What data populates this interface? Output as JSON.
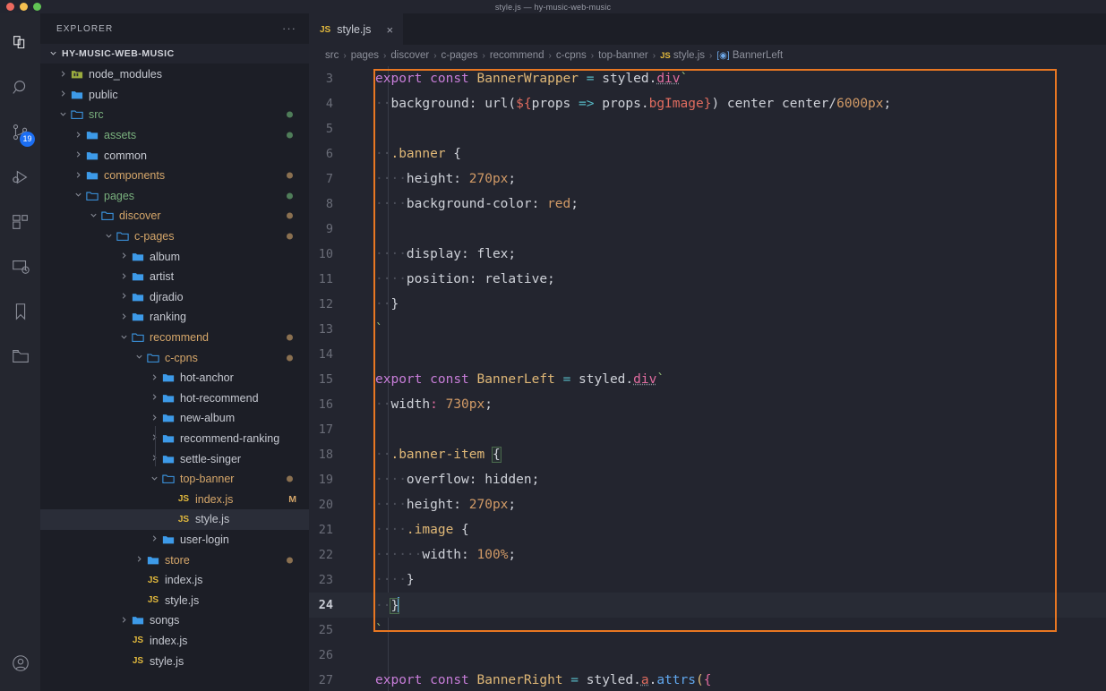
{
  "window": {
    "title": "style.js — hy-music-web-music",
    "traffic_lights": [
      "close",
      "minimize",
      "zoom"
    ]
  },
  "activity_bar": {
    "items": [
      {
        "name": "explorer-icon",
        "label": "Explorer",
        "active": true,
        "badge": null
      },
      {
        "name": "search-icon",
        "label": "Search",
        "active": false,
        "badge": null
      },
      {
        "name": "source-control-icon",
        "label": "Source Control",
        "active": false,
        "badge": "19"
      },
      {
        "name": "run-and-debug-icon",
        "label": "Run and Debug",
        "active": false,
        "badge": null
      },
      {
        "name": "extensions-icon",
        "label": "Extensions",
        "active": false,
        "badge": null
      },
      {
        "name": "remote-explorer-icon",
        "label": "Remote Explorer",
        "active": false,
        "badge": null
      },
      {
        "name": "bookmarks-icon",
        "label": "Bookmarks",
        "active": false,
        "badge": null
      },
      {
        "name": "project-manager-icon",
        "label": "Project Manager",
        "active": false,
        "badge": null
      }
    ],
    "bottom": [
      {
        "name": "accounts-icon",
        "label": "Accounts"
      }
    ]
  },
  "sidebar": {
    "header_title": "EXPLORER",
    "more_actions": "···",
    "root_label": "HY-MUSIC-WEB-MUSIC",
    "root_chevron": "⌄",
    "tree": [
      {
        "label": "node_modules",
        "depth": 1,
        "type": "folder-special",
        "state": "collapsed",
        "status": null,
        "badge": null,
        "selected": false
      },
      {
        "label": "public",
        "depth": 1,
        "type": "folder",
        "state": "collapsed",
        "status": null,
        "badge": null,
        "selected": false
      },
      {
        "label": "src",
        "depth": 1,
        "type": "folder",
        "state": "expanded",
        "status": "new",
        "badge": null,
        "selected": false
      },
      {
        "label": "assets",
        "depth": 2,
        "type": "folder",
        "state": "collapsed",
        "status": "new",
        "badge": null,
        "selected": false
      },
      {
        "label": "common",
        "depth": 2,
        "type": "folder",
        "state": "collapsed",
        "status": null,
        "badge": null,
        "selected": false
      },
      {
        "label": "components",
        "depth": 2,
        "type": "folder",
        "state": "collapsed",
        "status": "modified",
        "badge": null,
        "selected": false
      },
      {
        "label": "pages",
        "depth": 2,
        "type": "folder",
        "state": "expanded",
        "status": "new",
        "badge": null,
        "selected": false
      },
      {
        "label": "discover",
        "depth": 3,
        "type": "folder",
        "state": "expanded",
        "status": "modified",
        "badge": null,
        "selected": false
      },
      {
        "label": "c-pages",
        "depth": 4,
        "type": "folder",
        "state": "expanded",
        "status": "modified",
        "badge": null,
        "selected": false
      },
      {
        "label": "album",
        "depth": 5,
        "type": "folder",
        "state": "collapsed",
        "status": null,
        "badge": null,
        "selected": false
      },
      {
        "label": "artist",
        "depth": 5,
        "type": "folder",
        "state": "collapsed",
        "status": null,
        "badge": null,
        "selected": false
      },
      {
        "label": "djradio",
        "depth": 5,
        "type": "folder",
        "state": "collapsed",
        "status": null,
        "badge": null,
        "selected": false
      },
      {
        "label": "ranking",
        "depth": 5,
        "type": "folder",
        "state": "collapsed",
        "status": null,
        "badge": null,
        "selected": false
      },
      {
        "label": "recommend",
        "depth": 5,
        "type": "folder",
        "state": "expanded",
        "status": "modified",
        "badge": null,
        "selected": false
      },
      {
        "label": "c-cpns",
        "depth": 6,
        "type": "folder",
        "state": "expanded",
        "status": "modified",
        "badge": null,
        "selected": false
      },
      {
        "label": "hot-anchor",
        "depth": 7,
        "type": "folder",
        "state": "collapsed",
        "status": null,
        "badge": null,
        "selected": false
      },
      {
        "label": "hot-recommend",
        "depth": 7,
        "type": "folder",
        "state": "collapsed",
        "status": null,
        "badge": null,
        "selected": false
      },
      {
        "label": "new-album",
        "depth": 7,
        "type": "folder",
        "state": "collapsed",
        "status": null,
        "badge": null,
        "selected": false
      },
      {
        "label": "recommend-ranking",
        "depth": 7,
        "type": "folder",
        "state": "collapsed",
        "status": null,
        "badge": null,
        "selected": false
      },
      {
        "label": "settle-singer",
        "depth": 7,
        "type": "folder",
        "state": "collapsed",
        "status": null,
        "badge": null,
        "selected": false
      },
      {
        "label": "top-banner",
        "depth": 7,
        "type": "folder",
        "state": "expanded",
        "status": "modified",
        "badge": null,
        "selected": false
      },
      {
        "label": "index.js",
        "depth": 8,
        "type": "js",
        "state": "file",
        "status": "modified",
        "badge": "M",
        "selected": false
      },
      {
        "label": "style.js",
        "depth": 8,
        "type": "js",
        "state": "file",
        "status": null,
        "badge": null,
        "selected": true
      },
      {
        "label": "user-login",
        "depth": 7,
        "type": "folder",
        "state": "collapsed",
        "status": null,
        "badge": null,
        "selected": false
      },
      {
        "label": "store",
        "depth": 6,
        "type": "folder",
        "state": "collapsed",
        "status": "modified",
        "badge": null,
        "selected": false
      },
      {
        "label": "index.js",
        "depth": 6,
        "type": "js",
        "state": "file",
        "status": null,
        "badge": null,
        "selected": false
      },
      {
        "label": "style.js",
        "depth": 6,
        "type": "js",
        "state": "file",
        "status": null,
        "badge": null,
        "selected": false
      },
      {
        "label": "songs",
        "depth": 5,
        "type": "folder",
        "state": "collapsed",
        "status": null,
        "badge": null,
        "selected": false
      },
      {
        "label": "index.js",
        "depth": 5,
        "type": "js",
        "state": "file",
        "status": null,
        "badge": null,
        "selected": false
      },
      {
        "label": "style.js",
        "depth": 5,
        "type": "js",
        "state": "file",
        "status": null,
        "badge": null,
        "selected": false
      }
    ]
  },
  "editor": {
    "tabs": [
      {
        "icon": "JS",
        "label": "style.js",
        "active": true,
        "close": "×"
      }
    ],
    "breadcrumb": [
      {
        "label": "src",
        "icon": null
      },
      {
        "label": "pages",
        "icon": null
      },
      {
        "label": "discover",
        "icon": null
      },
      {
        "label": "c-pages",
        "icon": null
      },
      {
        "label": "recommend",
        "icon": null
      },
      {
        "label": "c-cpns",
        "icon": null
      },
      {
        "label": "top-banner",
        "icon": null
      },
      {
        "label": "style.js",
        "icon": "JS"
      },
      {
        "label": "BannerLeft",
        "icon": "symbol-variable"
      }
    ],
    "breadcrumb_separator": "›",
    "active_line": 24,
    "highlight_color": "#e87722",
    "cursor_color": "#5b9dd9",
    "lines": [
      {
        "n": 3,
        "segments": [
          {
            "t": "export",
            "c": "kw"
          },
          {
            "t": " ",
            "c": "pl"
          },
          {
            "t": "const",
            "c": "kw"
          },
          {
            "t": " ",
            "c": "pl"
          },
          {
            "t": "BannerWrapper",
            "c": "vn"
          },
          {
            "t": " ",
            "c": "pl"
          },
          {
            "t": "=",
            "c": "op"
          },
          {
            "t": " styled.",
            "c": "pl"
          },
          {
            "t": "div",
            "c": "pink sq"
          },
          {
            "t": "`",
            "c": "tmpl"
          }
        ]
      },
      {
        "n": 4,
        "segments": [
          {
            "t": "··",
            "c": "ind"
          },
          {
            "t": "background: url(",
            "c": "pl"
          },
          {
            "t": "${",
            "c": "dollar"
          },
          {
            "t": "props ",
            "c": "pl"
          },
          {
            "t": "=>",
            "c": "op"
          },
          {
            "t": " props.",
            "c": "pl"
          },
          {
            "t": "bgImage",
            "c": "dollar"
          },
          {
            "t": "}",
            "c": "dollar"
          },
          {
            "t": ") center center/",
            "c": "pl"
          },
          {
            "t": "6000px",
            "c": "num"
          },
          {
            "t": ";",
            "c": "pl"
          }
        ]
      },
      {
        "n": 5,
        "segments": []
      },
      {
        "n": 6,
        "segments": [
          {
            "t": "··",
            "c": "ind"
          },
          {
            "t": ".banner",
            "c": "vn"
          },
          {
            "t": " {",
            "c": "pl"
          }
        ]
      },
      {
        "n": 7,
        "segments": [
          {
            "t": "····",
            "c": "ind"
          },
          {
            "t": "height: ",
            "c": "pl"
          },
          {
            "t": "270px",
            "c": "num"
          },
          {
            "t": ";",
            "c": "pl"
          }
        ]
      },
      {
        "n": 8,
        "segments": [
          {
            "t": "····",
            "c": "ind"
          },
          {
            "t": "background-color: ",
            "c": "pl"
          },
          {
            "t": "red",
            "c": "num"
          },
          {
            "t": ";",
            "c": "pl"
          }
        ]
      },
      {
        "n": 9,
        "segments": []
      },
      {
        "n": 10,
        "segments": [
          {
            "t": "····",
            "c": "ind"
          },
          {
            "t": "display: flex;",
            "c": "pl"
          }
        ]
      },
      {
        "n": 11,
        "segments": [
          {
            "t": "····",
            "c": "ind"
          },
          {
            "t": "position: relative;",
            "c": "pl"
          }
        ]
      },
      {
        "n": 12,
        "segments": [
          {
            "t": "··",
            "c": "ind"
          },
          {
            "t": "}",
            "c": "pl"
          }
        ]
      },
      {
        "n": 13,
        "segments": [
          {
            "t": "`",
            "c": "tmpl"
          }
        ]
      },
      {
        "n": 14,
        "segments": []
      },
      {
        "n": 15,
        "segments": [
          {
            "t": "export",
            "c": "kw"
          },
          {
            "t": " ",
            "c": "pl"
          },
          {
            "t": "const",
            "c": "kw"
          },
          {
            "t": " ",
            "c": "pl"
          },
          {
            "t": "BannerLeft",
            "c": "vn"
          },
          {
            "t": " ",
            "c": "pl"
          },
          {
            "t": "=",
            "c": "op"
          },
          {
            "t": " styled.",
            "c": "pl"
          },
          {
            "t": "div",
            "c": "pink sq"
          },
          {
            "t": "`",
            "c": "tmpl"
          }
        ]
      },
      {
        "n": 16,
        "segments": [
          {
            "t": "··",
            "c": "ind"
          },
          {
            "t": "width",
            "c": "pl"
          },
          {
            "t": ":",
            "c": "pink"
          },
          {
            "t": " ",
            "c": "pl"
          },
          {
            "t": "730px",
            "c": "num"
          },
          {
            "t": ";",
            "c": "pl"
          }
        ]
      },
      {
        "n": 17,
        "segments": []
      },
      {
        "n": 18,
        "segments": [
          {
            "t": "··",
            "c": "ind"
          },
          {
            "t": ".banner-item",
            "c": "vn"
          },
          {
            "t": " ",
            "c": "pl"
          },
          {
            "t": "{",
            "c": "pl brk"
          }
        ]
      },
      {
        "n": 19,
        "segments": [
          {
            "t": "····",
            "c": "ind"
          },
          {
            "t": "overflow: hidden;",
            "c": "pl"
          }
        ]
      },
      {
        "n": 20,
        "segments": [
          {
            "t": "····",
            "c": "ind"
          },
          {
            "t": "height: ",
            "c": "pl"
          },
          {
            "t": "270px",
            "c": "num"
          },
          {
            "t": ";",
            "c": "pl"
          }
        ]
      },
      {
        "n": 21,
        "segments": [
          {
            "t": "····",
            "c": "ind"
          },
          {
            "t": ".image",
            "c": "vn"
          },
          {
            "t": " {",
            "c": "pl"
          }
        ]
      },
      {
        "n": 22,
        "segments": [
          {
            "t": "······",
            "c": "ind"
          },
          {
            "t": "width: ",
            "c": "pl"
          },
          {
            "t": "100%",
            "c": "num"
          },
          {
            "t": ";",
            "c": "pl"
          }
        ]
      },
      {
        "n": 23,
        "segments": [
          {
            "t": "····",
            "c": "ind"
          },
          {
            "t": "}",
            "c": "pl"
          }
        ]
      },
      {
        "n": 24,
        "segments": [
          {
            "t": "··",
            "c": "ind"
          },
          {
            "t": "}",
            "c": "pl brk"
          }
        ],
        "cursor": true
      },
      {
        "n": 25,
        "segments": [
          {
            "t": "`",
            "c": "tmpl"
          }
        ]
      },
      {
        "n": 26,
        "segments": []
      },
      {
        "n": 27,
        "segments": [
          {
            "t": "export",
            "c": "kw"
          },
          {
            "t": " ",
            "c": "pl"
          },
          {
            "t": "const",
            "c": "kw"
          },
          {
            "t": " ",
            "c": "pl"
          },
          {
            "t": "BannerRight",
            "c": "vn"
          },
          {
            "t": " ",
            "c": "pl"
          },
          {
            "t": "=",
            "c": "op"
          },
          {
            "t": " styled.",
            "c": "pl"
          },
          {
            "t": "a",
            "c": "dollar sq"
          },
          {
            "t": ".",
            "c": "pl"
          },
          {
            "t": "attrs",
            "c": "fn"
          },
          {
            "t": "(",
            "c": "yellowb"
          },
          {
            "t": "{",
            "c": "pink"
          }
        ]
      }
    ]
  }
}
